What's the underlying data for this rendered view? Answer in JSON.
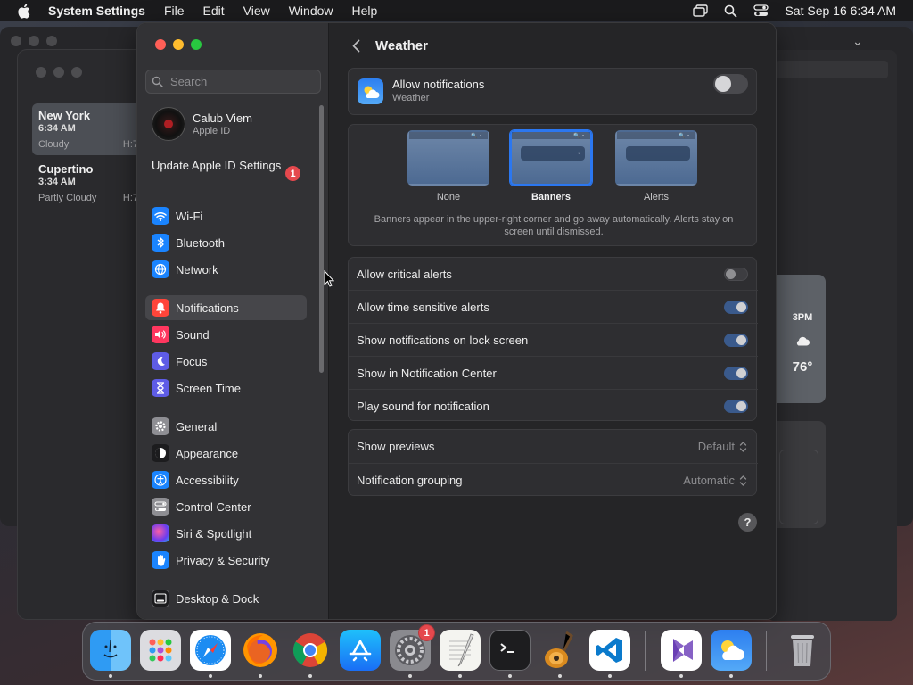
{
  "menubar": {
    "app_name": "System Settings",
    "menus": [
      "File",
      "Edit",
      "View",
      "Window",
      "Help"
    ],
    "clock": "Sat Sep 16  6:34 AM",
    "icons": [
      "apple-icon",
      "screen-mirroring-icon",
      "spotlight-search-icon",
      "control-center-icon"
    ]
  },
  "weather_app": {
    "cities": [
      {
        "name": "New York",
        "time": "6:34 AM",
        "condition": "Cloudy",
        "hl": "H:7"
      },
      {
        "name": "Cupertino",
        "time": "3:34 AM",
        "condition": "Partly Cloudy",
        "hl": "H:7"
      }
    ],
    "forecast": {
      "hour": "3PM",
      "temp": "76°"
    }
  },
  "sidebar": {
    "search_placeholder": "Search",
    "profile": {
      "name": "Calub Viem",
      "subtitle": "Apple ID"
    },
    "update_text": "Update Apple ID Settings",
    "update_badge": "1",
    "items": [
      {
        "label": "Wi-Fi",
        "icon": "wifi-icon",
        "color": "#1a84ff"
      },
      {
        "label": "Bluetooth",
        "icon": "bluetooth-icon",
        "color": "#1a84ff"
      },
      {
        "label": "Network",
        "icon": "globe-icon",
        "color": "#1a84ff"
      },
      {
        "label": "Notifications",
        "icon": "bell-icon",
        "color": "#ff453a"
      },
      {
        "label": "Sound",
        "icon": "speaker-icon",
        "color": "#ff375f"
      },
      {
        "label": "Focus",
        "icon": "moon-icon",
        "color": "#5e5ce6"
      },
      {
        "label": "Screen Time",
        "icon": "hourglass-icon",
        "color": "#5e5ce6"
      },
      {
        "label": "General",
        "icon": "gear-icon",
        "color": "#8e8e93"
      },
      {
        "label": "Appearance",
        "icon": "appearance-icon",
        "color": "#1c1c1e"
      },
      {
        "label": "Accessibility",
        "icon": "accessibility-icon",
        "color": "#1a84ff"
      },
      {
        "label": "Control Center",
        "icon": "control-center-icon",
        "color": "#8e8e93"
      },
      {
        "label": "Siri & Spotlight",
        "icon": "siri-icon",
        "color": "#b04fd6"
      },
      {
        "label": "Privacy & Security",
        "icon": "hand-icon",
        "color": "#1a84ff"
      },
      {
        "label": "Desktop & Dock",
        "icon": "dock-icon",
        "color": "#1c1c1e"
      }
    ],
    "selected": "Notifications"
  },
  "content": {
    "title": "Weather",
    "allow": {
      "title": "Allow notifications",
      "app": "Weather",
      "enabled": false
    },
    "styles": {
      "options": [
        "None",
        "Banners",
        "Alerts"
      ],
      "selected": "Banners",
      "description": "Banners appear in the upper-right corner and go away automatically. Alerts stay on screen until dismissed."
    },
    "toggles": [
      {
        "label": "Allow critical alerts",
        "on": false
      },
      {
        "label": "Allow time sensitive alerts",
        "on": true
      },
      {
        "label": "Show notifications on lock screen",
        "on": true
      },
      {
        "label": "Show in Notification Center",
        "on": true
      },
      {
        "label": "Play sound for notification",
        "on": true
      }
    ],
    "selects": [
      {
        "label": "Show previews",
        "value": "Default"
      },
      {
        "label": "Notification grouping",
        "value": "Automatic"
      }
    ],
    "help": "?"
  },
  "dock": {
    "apps": [
      "Finder",
      "Launchpad",
      "Safari",
      "Firefox",
      "Chrome",
      "App Store",
      "System Settings",
      "TextEdit",
      "Terminal",
      "GarageBand",
      "Visual Studio Code",
      "Visual Studio",
      "Weather",
      "Trash"
    ],
    "system_settings_badge": "1"
  }
}
